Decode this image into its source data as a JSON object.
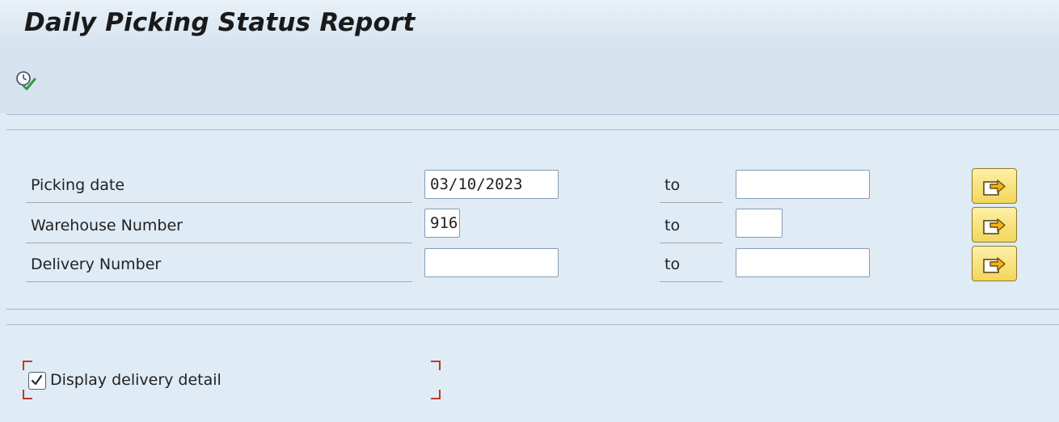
{
  "title": "Daily Picking Status Report",
  "toolbar": {
    "execute_icon": "execute-clock-check-icon"
  },
  "selection": {
    "rows": [
      {
        "label": "Picking date",
        "from_value": "03/10/2023",
        "to_label": "to",
        "to_value": "",
        "button_icon": "multiple-selection-arrow-icon"
      },
      {
        "label": "Warehouse Number",
        "from_value": "916",
        "to_label": "to",
        "to_value": "",
        "button_icon": "multiple-selection-arrow-icon"
      },
      {
        "label": "Delivery Number",
        "from_value": "",
        "to_label": "to",
        "to_value": "",
        "button_icon": "multiple-selection-arrow-icon"
      }
    ]
  },
  "options": {
    "display_delivery_detail": {
      "label": "Display delivery detail",
      "checked": true
    }
  },
  "colors": {
    "background": "#dfebf5",
    "button_yellow": "#f3d65a",
    "focus_corner_red": "#c0392b",
    "execute_green": "#2e9b3a"
  }
}
